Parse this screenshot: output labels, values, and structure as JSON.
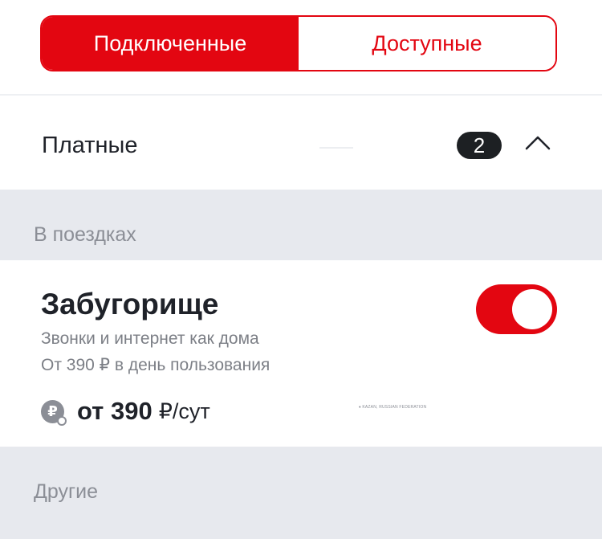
{
  "tabs": {
    "connected_label": "Подключенные",
    "available_label": "Доступные",
    "active": "connected"
  },
  "paid_group": {
    "title": "Платные",
    "count": "2",
    "chevron_icon": "chevron-up-icon"
  },
  "sections": [
    {
      "label": "В поездках"
    },
    {
      "label": "Другие"
    }
  ],
  "service": {
    "title": "Забугорище",
    "description_line1": "Звонки и интернет как дома",
    "description_line2": "От 390 ₽ в день пользования",
    "price_icon": "ruble-coin-icon",
    "price": "от 390",
    "price_unit": "₽/сут",
    "enabled": true,
    "watermark": "♦ KAZAN, RUSSIAN FEDERATION"
  },
  "colors": {
    "accent": "#e30611",
    "band_background": "#e7e9ee",
    "badge_background": "#1d2023",
    "muted_text": "#7c7f86"
  }
}
